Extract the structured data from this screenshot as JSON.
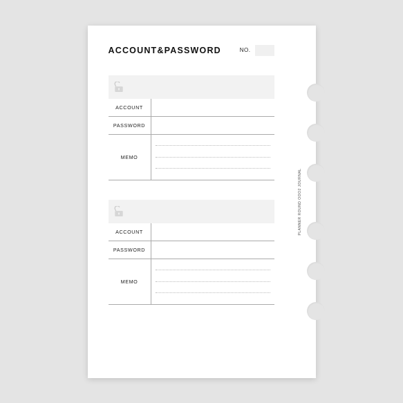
{
  "header": {
    "title": "ACCOUNT&PASSWORD",
    "no_label": "NO."
  },
  "side_text": "PLANNER ROUND  OOO2 JOURNAL",
  "entries": [
    {
      "account_label": "ACCOUNT",
      "password_label": "PASSWORD",
      "memo_label": "MEMO"
    },
    {
      "account_label": "ACCOUNT",
      "password_label": "PASSWORD",
      "memo_label": "MEMO"
    }
  ]
}
